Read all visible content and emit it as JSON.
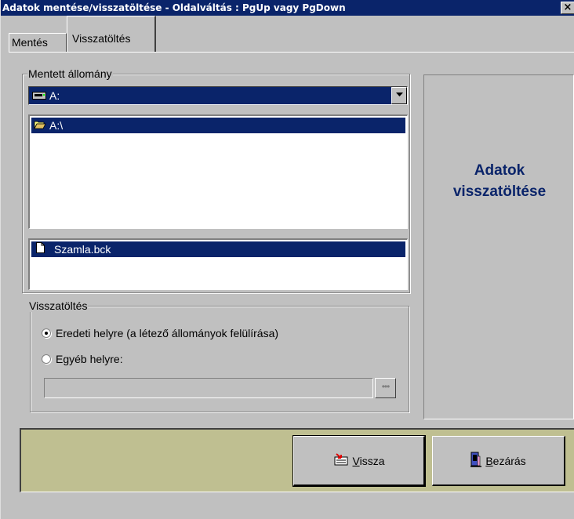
{
  "window": {
    "title": "Adatok mentése/visszatöltése - Oldalváltás : PgUp vagy PgDown",
    "close_label": "×"
  },
  "tabs": [
    {
      "label": "Mentés"
    },
    {
      "label": "Visszatöltés"
    }
  ],
  "saved_file_group": {
    "legend": "Mentett állomány",
    "drive_combo": {
      "value": "A:",
      "icon": "drive-icon"
    },
    "folder_list": {
      "selected": "A:\\",
      "icon": "open-folder-icon"
    },
    "file_list": {
      "selected": "Szamla.bck",
      "icon": "file-icon"
    }
  },
  "restore_group": {
    "legend": "Visszatöltés",
    "options": [
      {
        "label": "Eredeti helyre (a létező állományok felülírása)",
        "checked": true
      },
      {
        "label": "Egyéb helyre:",
        "checked": false
      }
    ],
    "path_value": "",
    "browse_label": "•••"
  },
  "side_panel": {
    "line1": "Adatok",
    "line2": "visszatöltése"
  },
  "buttons": {
    "back": {
      "mnemonic": "V",
      "rest": "issza",
      "icon": "back-arrow-icon"
    },
    "close": {
      "mnemonic": "B",
      "rest": "ezárás",
      "icon": "door-exit-icon"
    }
  },
  "colors": {
    "title_bg": "#0a246a",
    "selection_bg": "#0a246a",
    "panel_text": "#0a246a",
    "bottom_bar": "#bfbf91",
    "face": "#c0c0c0"
  }
}
